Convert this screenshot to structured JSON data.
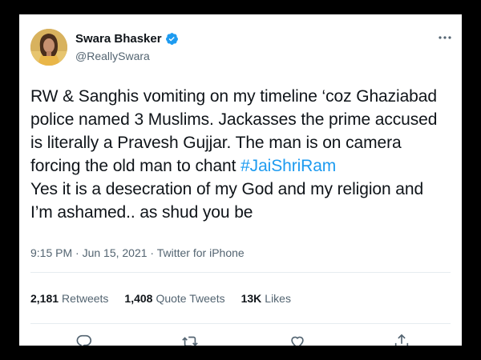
{
  "tweet": {
    "author": {
      "display_name": "Swara Bhasker",
      "handle": "@ReallySwara",
      "verified": true
    },
    "more_icon": "ellipsis-icon",
    "text_lines": [
      {
        "text": "RW & Sanghis vomiting on my timeline ‘coz Ghaziabad"
      },
      {
        "text": "police named 3 Muslims. Jackasses the prime accused"
      },
      {
        "text": "is literally a Pravesh Gujjar. The man is on camera"
      },
      {
        "before": "forcing the old man to chant ",
        "hashtag": "#JaiShriRam"
      },
      {
        "text": "Yes it is a desecration of my God and my religion and"
      },
      {
        "text": "I’m ashamed.. as shud you be"
      }
    ],
    "timestamp": "9:15 PM · Jun 15, 2021 · ",
    "source": "Twitter for iPhone",
    "stats": {
      "retweets": {
        "count": "2,181",
        "label": "Retweets"
      },
      "quote_tweets": {
        "count": "1,408",
        "label": "Quote Tweets"
      },
      "likes": {
        "count": "13K",
        "label": "Likes"
      }
    },
    "actions": [
      "reply-icon",
      "retweet-icon",
      "like-icon",
      "share-icon"
    ],
    "colors": {
      "accent": "#1d9bf0",
      "text": "#0f1419",
      "secondary": "#536471",
      "frame_border": "#000000"
    }
  }
}
